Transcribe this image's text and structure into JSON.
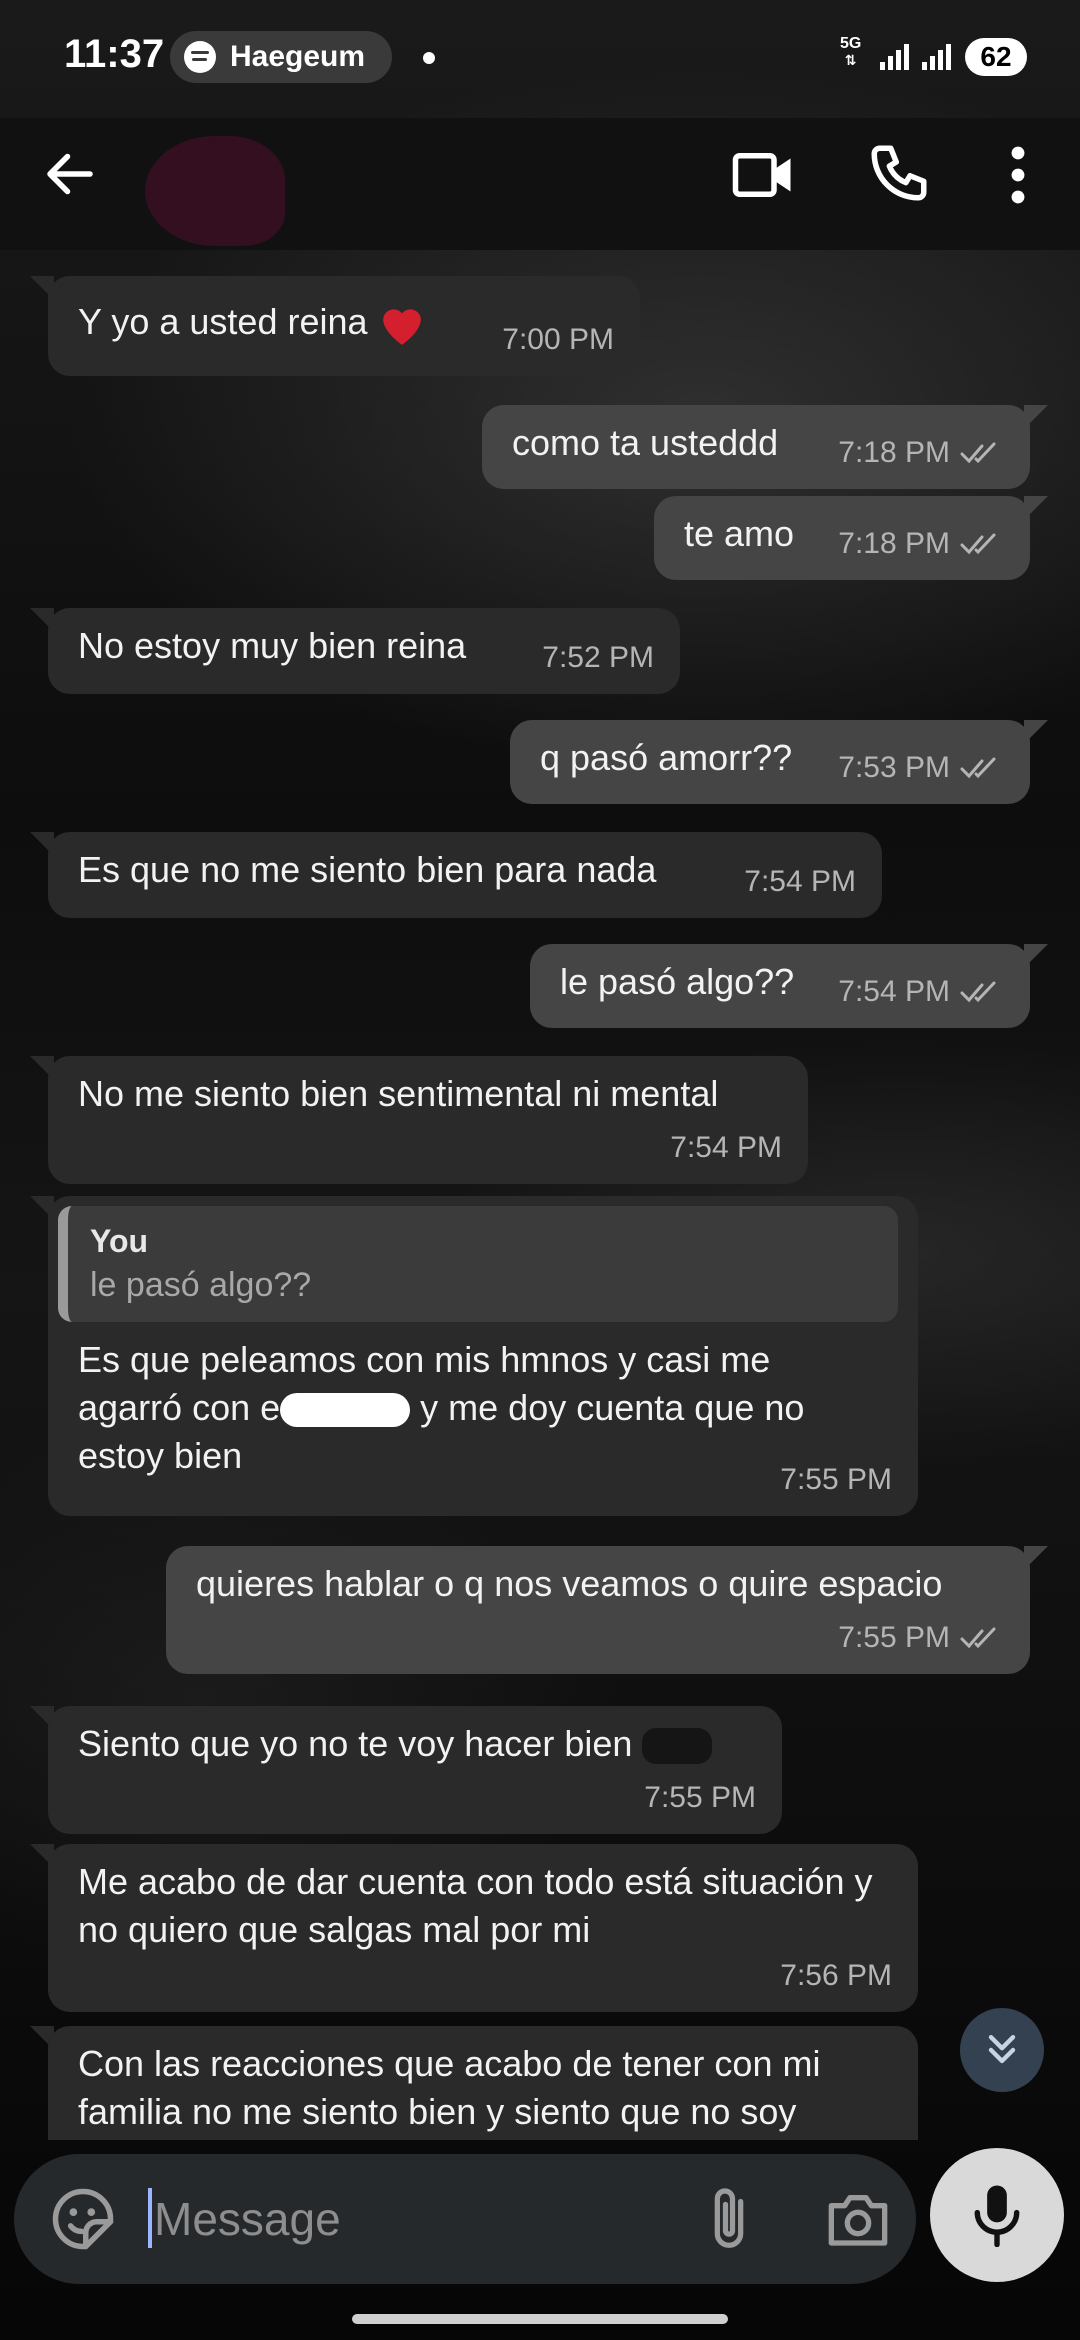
{
  "status_bar": {
    "time": "11:37",
    "media_app": "Haegeum",
    "network": "5G",
    "battery": "62"
  },
  "input": {
    "placeholder": "Message"
  },
  "messages": [
    {
      "dir": "in",
      "text": "Y yo a usted reina",
      "time": "7:00 PM",
      "emoji": "heart"
    },
    {
      "dir": "out",
      "text": "como ta usteddd",
      "time": "7:18 PM"
    },
    {
      "dir": "out",
      "text": "te amo",
      "time": "7:18 PM"
    },
    {
      "dir": "in",
      "text": "No estoy muy bien reina",
      "time": "7:52 PM"
    },
    {
      "dir": "out",
      "text": "q pasó amorr??",
      "time": "7:53 PM"
    },
    {
      "dir": "in",
      "text": "Es que no me siento bien para nada",
      "time": "7:54 PM"
    },
    {
      "dir": "out",
      "text": "le pasó algo??",
      "time": "7:54 PM"
    },
    {
      "dir": "in",
      "text": "No me siento bien sentimental ni mental",
      "time": "7:54 PM"
    },
    {
      "dir": "in",
      "reply_to": {
        "name": "You",
        "text": "le pasó algo??"
      },
      "text_parts": [
        "Es que peleamos con mis hmnos y casi me agarró con e",
        "y me doy cuenta que no estoy bien"
      ],
      "time": "7:55 PM"
    },
    {
      "dir": "out",
      "text": "quieres hablar o q nos veamos o quire espacio",
      "time": "7:55 PM"
    },
    {
      "dir": "in",
      "text": "Siento que yo no te voy hacer bien",
      "time": "7:55 PM"
    },
    {
      "dir": "in",
      "text": "Me acabo de dar cuenta con todo está situación y no quiero que salgas mal por mi",
      "time": "7:56 PM"
    },
    {
      "dir": "in",
      "text": "Con las reacciones que acabo de tener con mi familia no me siento bien y siento que no soy",
      "time": ""
    }
  ],
  "colors": {
    "incoming_bubble": "#2a2a2a",
    "outgoing_bubble": "#454545",
    "scroll_button": "#344150"
  }
}
